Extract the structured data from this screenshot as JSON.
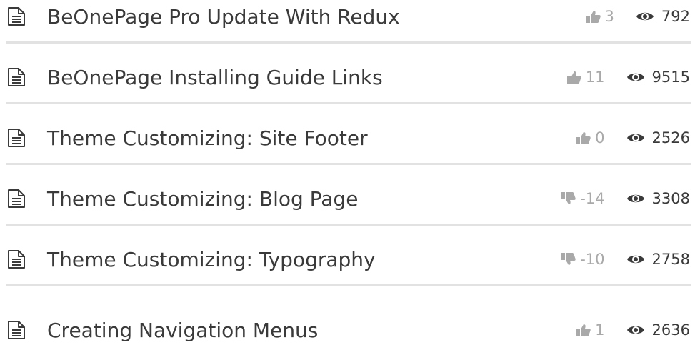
{
  "articles": [
    {
      "title": "BeOnePage Pro Update With Redux",
      "vote_icon": "thumbs-up-icon",
      "votes": "3",
      "views": "792"
    },
    {
      "title": "BeOnePage Installing Guide Links",
      "vote_icon": "thumbs-up-icon",
      "votes": "11",
      "views": "9515"
    },
    {
      "title": "Theme Customizing: Site Footer",
      "vote_icon": "thumbs-up-icon",
      "votes": "0",
      "views": "2526"
    },
    {
      "title": "Theme Customizing: Blog Page",
      "vote_icon": "thumbs-down-icon",
      "votes": "-14",
      "views": "3308"
    },
    {
      "title": "Theme Customizing: Typography",
      "vote_icon": "thumbs-down-icon",
      "votes": "-10",
      "views": "2758"
    },
    {
      "title": "Creating Navigation Menus",
      "vote_icon": "thumbs-up-icon",
      "votes": "1",
      "views": "2636"
    }
  ],
  "colors": {
    "text": "#3a3a3a",
    "muted": "#a9a9a9",
    "divider": "#e2e2e2"
  }
}
